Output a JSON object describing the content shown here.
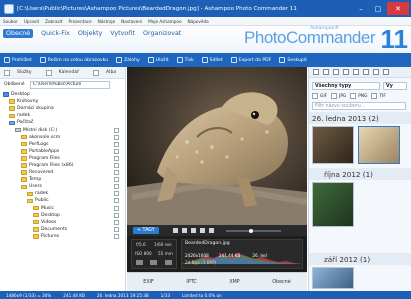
{
  "window": {
    "title": "[C:\\Users\\Public\\Pictures\\Ashampoo Pictures\\BeardedDragon.jpg] - Ashampoo Photo Commander 11",
    "min": "–",
    "max": "□",
    "close": "✕"
  },
  "menu": [
    "Soubor",
    "Upravit",
    "Zobrazit",
    "Prezentace",
    "Nástroje",
    "Nastavení",
    "Moje Ashampoo",
    "Nápověda"
  ],
  "tabs": [
    {
      "label": "Obecné",
      "active": true
    },
    {
      "label": "Quick-Fix",
      "active": false
    },
    {
      "label": "Objekty",
      "active": false
    },
    {
      "label": "Vytvořit",
      "active": false
    },
    {
      "label": "Organizovat",
      "active": false
    }
  ],
  "brand": {
    "ashampoo": "Ashampoo®",
    "name": "PhotoCommander",
    "version": "11"
  },
  "toolbar": [
    "Prohlížet",
    "Režim na celou obrazovku",
    "Zálohy",
    "Uložit",
    "Tisk",
    "Sdílet",
    "Export do PDF",
    "Seskupit"
  ],
  "left_tabs": [
    "Složky",
    "Kalendář",
    "Alba"
  ],
  "favorites": {
    "label": "Oblíbené",
    "path": "C:\\Users\\Public\\Picture"
  },
  "tree": [
    {
      "label": "Desktop",
      "icon": "desktop",
      "depth": 0
    },
    {
      "label": "Knihovny",
      "icon": "folder",
      "depth": 1
    },
    {
      "label": "Domácí skupina",
      "icon": "folder",
      "depth": 1
    },
    {
      "label": "radek",
      "icon": "folder",
      "depth": 1
    },
    {
      "label": "Počítač",
      "icon": "pc",
      "depth": 1
    },
    {
      "label": "Místní disk (C:)",
      "icon": "drive",
      "depth": 2
    },
    {
      "label": "akonsole.scm",
      "icon": "folder",
      "depth": 3
    },
    {
      "label": "PerfLogs",
      "icon": "folder",
      "depth": 3
    },
    {
      "label": "PortableApps",
      "icon": "folder",
      "depth": 3
    },
    {
      "label": "Program Files",
      "icon": "folder",
      "depth": 3
    },
    {
      "label": "Program Files (x86)",
      "icon": "folder",
      "depth": 3
    },
    {
      "label": "Recovered",
      "icon": "folder",
      "depth": 3
    },
    {
      "label": "Temp",
      "icon": "folder",
      "depth": 3
    },
    {
      "label": "Users",
      "icon": "folder",
      "depth": 3
    },
    {
      "label": "radek",
      "icon": "folder",
      "depth": 4
    },
    {
      "label": "Public",
      "icon": "folder",
      "depth": 4
    },
    {
      "label": "Music",
      "icon": "folder",
      "depth": 5
    },
    {
      "label": "Desktop",
      "icon": "folder",
      "depth": 5
    },
    {
      "label": "Videos",
      "icon": "folder",
      "depth": 5
    },
    {
      "label": "Documents",
      "icon": "folder",
      "depth": 5
    },
    {
      "label": "Pictures",
      "icon": "folder",
      "depth": 5
    }
  ],
  "tags": {
    "label": "+ TAGY"
  },
  "info": {
    "aperture": "f/5.6",
    "shutter": "1/60 sec",
    "iso": "ISO 800",
    "focal": "55 mm",
    "filename": "BeardedDragon.jpg",
    "dims": "2426x1608",
    "size": "241.44 KB",
    "date": "26. led",
    "bitdepth": "24 Bpp (1 BPP)"
  },
  "info_tabs": [
    "EXIF",
    "IPTC",
    "XMP",
    "Obecné"
  ],
  "right": {
    "filter": "Všechny typy",
    "filter2": "Vy",
    "checks": [
      "GIF",
      "JPG",
      "PNG",
      "TIF"
    ],
    "search_placeholder": "Filtr názvu souboru...",
    "groups": [
      {
        "date": "26. ledna 2013 (2)"
      },
      {
        "date": "října 2012 (1)"
      },
      {
        "date": "září 2012 (1)"
      }
    ]
  },
  "status": [
    "1486x9 (1/33) = 30%",
    "241.44 KB",
    "26. ledna 2013 19:25:38",
    "1/33",
    "Limited to 0.0% on"
  ],
  "colors": {
    "accent": "#1c5fb4",
    "toolbar": "#1f66bf",
    "brand": "#2d82d8"
  }
}
